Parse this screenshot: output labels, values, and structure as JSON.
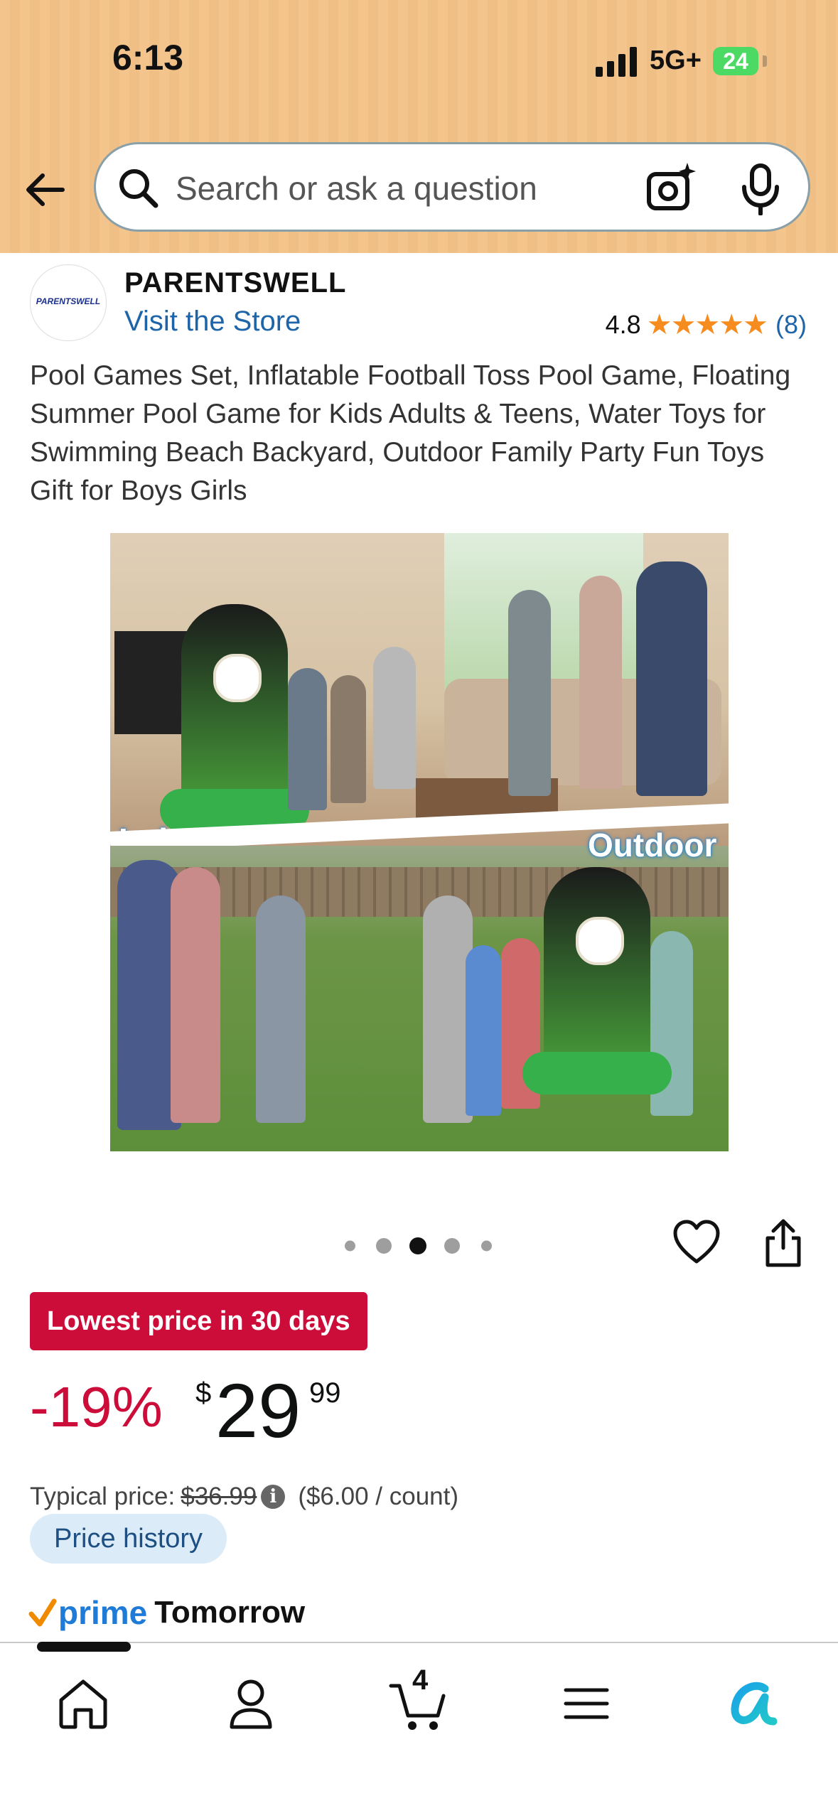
{
  "status_bar": {
    "time": "6:13",
    "network": "5G+",
    "battery": "24"
  },
  "search": {
    "placeholder": "Search or ask a question"
  },
  "store": {
    "logo_text": "PARENTSWELL",
    "name": "PARENTSWELL",
    "visit_link": "Visit the Store",
    "rating": "4.8",
    "stars": "★★★★★",
    "review_count": "(8)"
  },
  "product": {
    "title": "Pool Games Set, Inflatable Football Toss Pool Game, Floating Summer Pool Game for Kids Adults & Teens, Water Toys for Swimming Beach Backyard, Outdoor Family Party Fun Toys Gift for Boys Girls",
    "image_labels": {
      "indoor": "Indoor",
      "outdoor": "Outdoor"
    },
    "image_carousel": {
      "count": 5,
      "active_index": 2
    }
  },
  "pricing": {
    "deal_badge": "Lowest price in 30 days",
    "discount": "-19%",
    "currency": "$",
    "price_whole": "29",
    "price_fraction": "99",
    "typical_label": "Typical price:",
    "typical_price": "$36.99",
    "info_glyph": "i",
    "unit_price": "($6.00 / count)",
    "history_button": "Price history"
  },
  "delivery": {
    "prime_label": "prime",
    "delivery_day": "Tomorrow"
  },
  "tab_bar": {
    "cart_count": "4",
    "items": [
      "home-icon",
      "account-icon",
      "cart-icon",
      "menu-icon",
      "rufus-icon"
    ]
  },
  "colors": {
    "header_bg": "#f3c48b",
    "deal_red": "#cc0c39",
    "link_blue": "#1e64a8",
    "star_orange": "#f68b1e",
    "prime_blue": "#1e7bd7"
  }
}
